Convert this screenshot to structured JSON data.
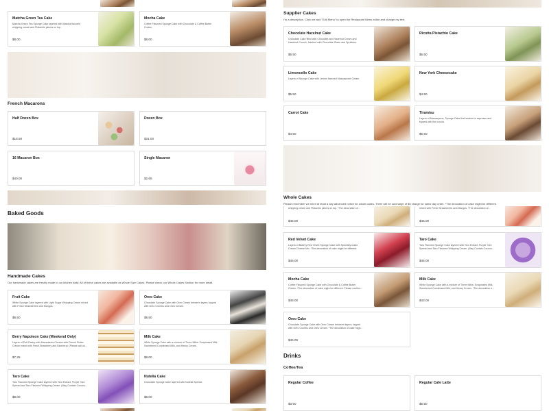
{
  "left": {
    "items_top": [
      {
        "name": "Matcha Green Tea Cake",
        "desc": "Matcha Green Tea Sponge Cake layered with Matcha flavored whipping cream and Pistachio pieces on top.",
        "price": "$8.00"
      },
      {
        "name": "Mocha Cake",
        "desc": "Coffee Flavored Sponge Cake with Chocolate & Coffee Butter Cream.",
        "price": "$8.00"
      }
    ],
    "french_macarons": {
      "heading": "French Macarons",
      "items": [
        {
          "name": "Half Dozen Box",
          "desc": "",
          "price": "$15.50"
        },
        {
          "name": "Dozen Box",
          "desc": "",
          "price": "$31.00"
        },
        {
          "name": "16 Macaron Box",
          "desc": "",
          "price": "$40.00"
        },
        {
          "name": "Single Macaron",
          "desc": "",
          "price": "$2.65"
        }
      ]
    },
    "baked_goods_heading": "Baked Goods",
    "handmade": {
      "heading": "Handmade Cakes",
      "note": "Our handmade cakes are freshly made in our kitchen daily. All of these cakes are available as Whole Size Cakes. Please check our Whole Cakes Section for more detail.",
      "items": [
        {
          "name": "Fruit Cake",
          "desc": "White Sponge Cake layered with Light Sugar Whipping Cream mixed with Fresh Strawberries and Mangos.",
          "price": "$8.50"
        },
        {
          "name": "Oreo Cake",
          "desc": "Chocolate Sponge Cake with Oreo Cream between layers; topped with Oreo Crumbs and Oreo Cream.",
          "price": "$8.50"
        },
        {
          "name": "Berry Napoleon Cake (Weekend Only)",
          "desc": "Layers of Puff Pastry with Macadamia Cheese with French Butter Cream mixed with Fresh Strawberry and Blueberry. (Please call us...",
          "price": "$7.25"
        },
        {
          "name": "Milk Cake",
          "desc": "White Sponge Cake with a mixture of Three Milks: Evaporated Milk, Sweetened Condensed Milk, and Heavy Cream.",
          "price": "$8.00"
        },
        {
          "name": "Taro Cake",
          "desc": "Taro Flavored Sponge Cake layered with Taro Extract, Purple Yam Spread and Taro Flavored Whipping Cream. (May Contain Coconu...",
          "price": "$8.00"
        },
        {
          "name": "Nutella Cake",
          "desc": "Chocolate Sponge Cake layered with Nutella Spread.",
          "price": "$8.00"
        }
      ]
    }
  },
  "right": {
    "supplier": {
      "heading": "Supplier Cakes",
      "note": "I'm a description. Click me and \"Edit Menu\" to open the Restaurant Menu editor and change my text.",
      "items": [
        {
          "name": "Chocolate Hazelnut Cake",
          "desc": "Chocolate Cake filled with Chocolate and Hazelnut Cream and Hazelnut Crunch, finished with Chocolate Glaze and Sprinkles.",
          "price": "$5.50"
        },
        {
          "name": "Ricotta Pistachio Cake",
          "desc": "",
          "price": "$5.50"
        },
        {
          "name": "Limoncello Cake",
          "desc": "Layers of Sponge Cake with Lemon flavored Mascarpone Cream.",
          "price": "$5.50"
        },
        {
          "name": "New York Cheesecake",
          "desc": "",
          "price": "$4.50"
        },
        {
          "name": "Carrot Cake",
          "desc": "",
          "price": "$4.50"
        },
        {
          "name": "Tiramisu",
          "desc": "Layers of Mascarpone, Sponge Cake that soaked in espresso and topped with fine cocoa.",
          "price": "$5.50"
        }
      ]
    },
    "whole": {
      "heading": "Whole Cakes",
      "note": "Please remember we need at least a day advanced notice for whole cakes. There will be surcharge of $5 charge for same day order. *The decoration of cake might be different.",
      "peek_left": "whipping cream and Pistachio pieces on top. *The decoration of...",
      "peek_right": "mixed with Fresh Strawberries and Mangos. *The decoration of...",
      "peek_left_price": "$45.00",
      "peek_right_price": "$45.00",
      "items": [
        {
          "name": "Red Velvet Cake",
          "desc": "Layers of Buttery Red Velvet Sponge Cake with Specialty made Cream Cheese Mix. *The decoration of cake might be different.",
          "price": "$45.00"
        },
        {
          "name": "Taro Cake",
          "desc": "Taro Flavored Sponge Cake layered with Taro Extract, Purple Yam Spread and Taro Flavored Whipping Cream. (May Contain Coconu...",
          "price": "$45.00"
        },
        {
          "name": "Mocha Cake",
          "desc": "Coffee Flavored Sponge Cake with Chocolate & Coffee Butter Cream. *The decoration of cake might be different. Please confirm...",
          "price": "$45.00"
        },
        {
          "name": "Milk Cake",
          "desc": "White Sponge Cake with a mixture of Three Milks: Evaporated Milk, Sweetened Condensed Milk, and Heavy Cream. *The decoration o...",
          "price": "$43.00"
        },
        {
          "name": "Oreo Cake",
          "desc": "Chocolate Sponge Cake with Oreo Cream between layers; topped with Oreo Crumbs and Oreo Cream. *The decoration of cake migh...",
          "price": "$45.00"
        }
      ]
    },
    "drinks": {
      "heading": "Drinks",
      "sub": "Coffee/Tea",
      "items": [
        {
          "name": "Regular Coffee",
          "desc": "",
          "price": "$3.50"
        },
        {
          "name": "Regular Cafe Latte",
          "desc": "",
          "price": "$5.50"
        }
      ]
    }
  }
}
